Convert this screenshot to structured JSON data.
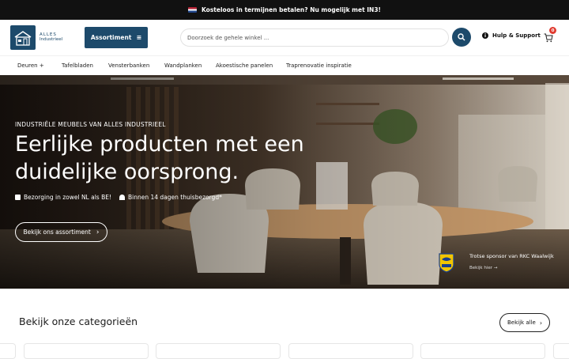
{
  "topbar": {
    "message": "Kosteloos in termijnen betalen? Nu mogelijk met IN3!"
  },
  "header": {
    "logo_line1": "ALLES",
    "logo_line2": "Industrieel",
    "assortment_label": "Assortiment",
    "search_placeholder": "Doorzoek de gehele winkel ...",
    "help_label": "Hulp & Support",
    "cart_count": "0"
  },
  "nav": {
    "items": [
      {
        "label": "Deuren  +"
      },
      {
        "label": "Tafelbladen"
      },
      {
        "label": "Vensterbanken"
      },
      {
        "label": "Wandplanken"
      },
      {
        "label": "Akoestische panelen"
      },
      {
        "label": "Traprenovatie inspiratie"
      }
    ]
  },
  "hero": {
    "eyebrow": "INDUSTRIËLE MEUBELS VAN ALLES INDUSTRIEEL",
    "heading": "Eerlijke producten met een duidelijke oorsprong.",
    "usp1": "Bezorging in zowel NL als BE!",
    "usp2": "Binnen 14 dagen thuisbezorgd*",
    "cta_label": "Bekijk ons assortiment",
    "sponsor_title": "Trotse sponsor van RKC Waalwijk",
    "sponsor_link": "Bekijk hier →"
  },
  "categories": {
    "title": "Bekijk onze categorieën",
    "see_all_label": "Bekijk alle"
  },
  "colors": {
    "brand": "#1d4a6b",
    "topbar": "#111111",
    "cart_badge": "#e03a2f"
  }
}
